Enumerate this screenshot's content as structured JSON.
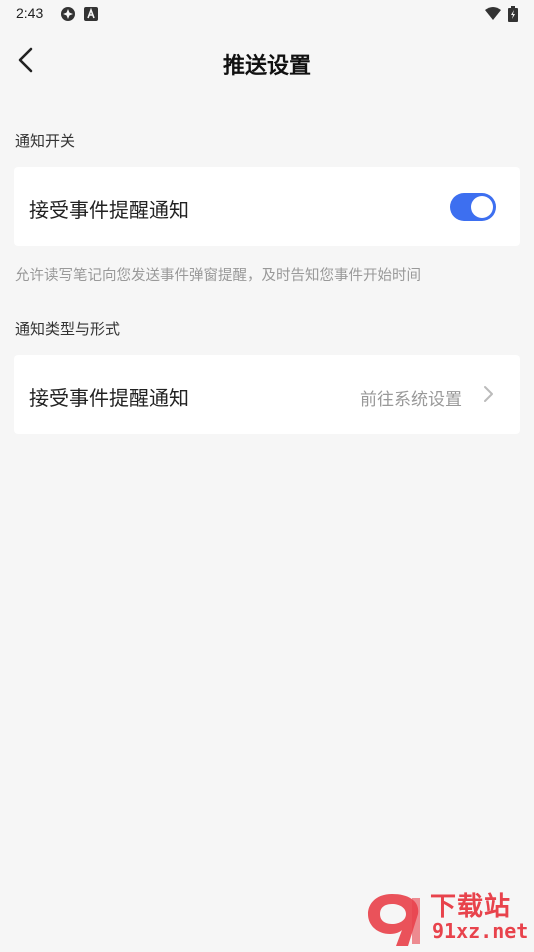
{
  "status_bar": {
    "time": "2:43"
  },
  "header": {
    "title": "推送设置"
  },
  "section1": {
    "label": "通知开关",
    "toggle_row": {
      "label": "接受事件提醒通知",
      "enabled": true
    },
    "hint": "允许读写笔记向您发送事件弹窗提醒，及时告知您事件开始时间"
  },
  "section2": {
    "label": "通知类型与形式",
    "nav_row": {
      "label": "接受事件提醒通知",
      "value": "前往系统设置"
    }
  },
  "watermark": {
    "line1": "下载站",
    "line2": "91xz.net"
  },
  "colors": {
    "accent": "#3d6ff0",
    "background": "#f6f6f6",
    "watermark": "#e8434c"
  }
}
